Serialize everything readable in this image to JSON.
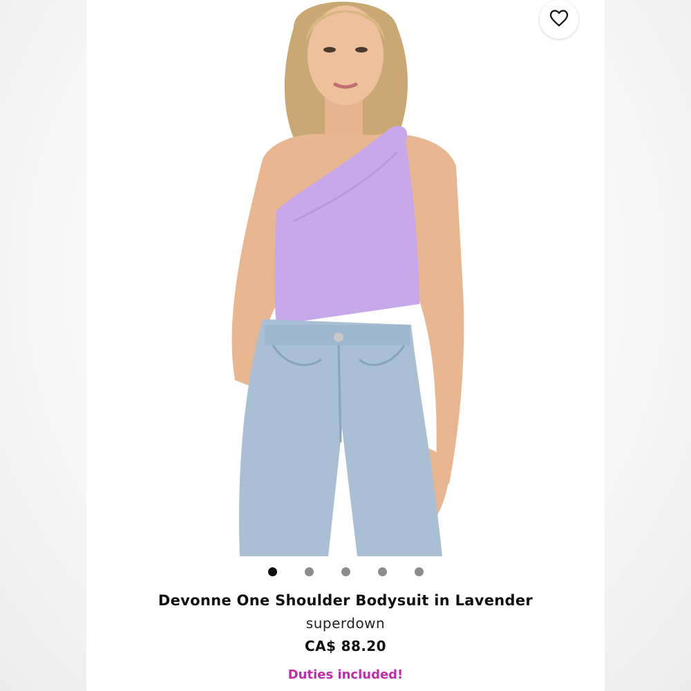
{
  "product": {
    "title": "Devonne One Shoulder Bodysuit in Lavender",
    "brand": "superdown",
    "price": "CA$ 88.20",
    "duties_note": "Duties included!"
  },
  "gallery": {
    "image_count": 5,
    "active_index": 0
  },
  "wishlist": {
    "icon": "heart-outline-icon"
  },
  "colors": {
    "accent": "#c22ca8",
    "bodysuit": "#c7a8ea",
    "denim": "#a9bfd6",
    "dot_active": "#111111",
    "dot_inactive": "#8c8c8c"
  }
}
